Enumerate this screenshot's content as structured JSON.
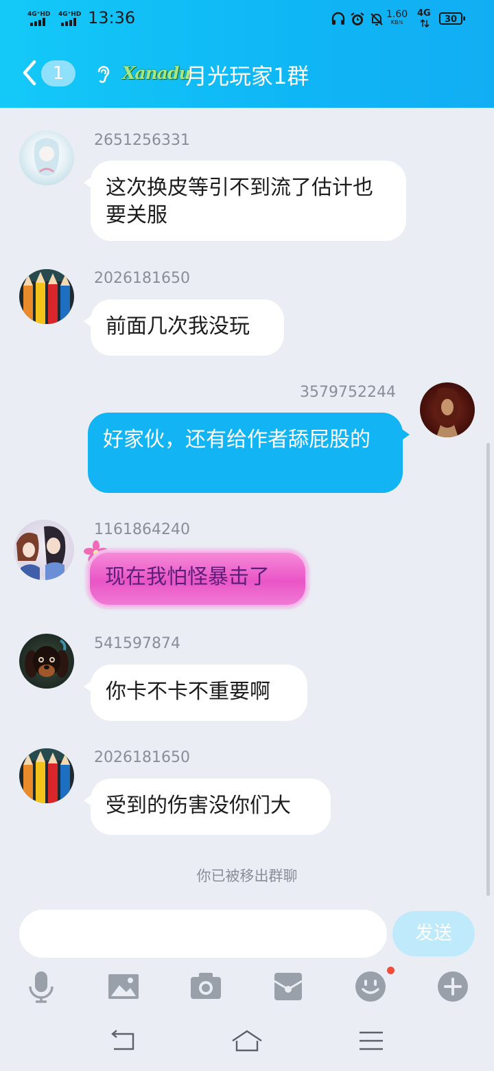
{
  "status_bar": {
    "signal_1": "4G⁺HD",
    "signal_2": "4G⁺HD",
    "time": "13:36",
    "net_speed": "1.60",
    "net_unit": "KB/s",
    "network": "4G",
    "battery": "30"
  },
  "header": {
    "unread_count": "1",
    "logo_text": "Xanadu",
    "title": "月光玩家1群"
  },
  "messages": [
    {
      "sender": "2651256331",
      "text": "这次换皮等引不到流了估计也要关服",
      "mine": false
    },
    {
      "sender": "2026181650",
      "text": "前面几次我没玩",
      "mine": false
    },
    {
      "sender": "3579752244",
      "text": "好家伙，还有给作者舔屁股的",
      "mine": true
    },
    {
      "sender": "1161864240",
      "text": "现在我怕怪暴击了",
      "mine": false
    },
    {
      "sender": "541597874",
      "text": "你卡不卡不重要啊",
      "mine": false
    },
    {
      "sender": "2026181650",
      "text": "受到的伤害没你们大",
      "mine": false
    }
  ],
  "system_message": "你已被移出群聊",
  "composer": {
    "placeholder": "",
    "send_label": "发送"
  },
  "toolbar": {
    "items": [
      "mic-icon",
      "image-icon",
      "camera-icon",
      "red-packet-icon",
      "emoji-icon",
      "plus-icon"
    ]
  },
  "colors": {
    "header": "#14c9f8",
    "my_bubble": "#12b4f4",
    "background": "#eaedf4"
  }
}
